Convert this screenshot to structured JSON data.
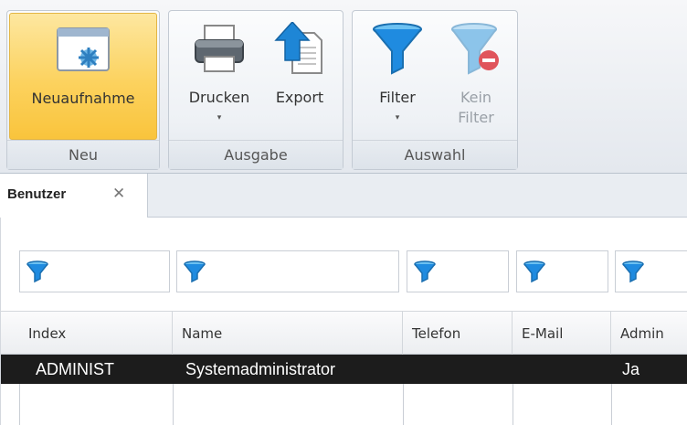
{
  "ribbon": {
    "groups": {
      "neu": {
        "label": "Neu",
        "buttons": {
          "neuaufnahme": "Neuaufnahme"
        }
      },
      "ausgabe": {
        "label": "Ausgabe",
        "buttons": {
          "drucken": "Drucken",
          "export": "Export"
        }
      },
      "auswahl": {
        "label": "Auswahl",
        "buttons": {
          "filter": "Filter",
          "kein_filter_1": "Kein",
          "kein_filter_2": "Filter"
        }
      }
    },
    "caret": "▾"
  },
  "tabs": [
    {
      "label": "Benutzer",
      "close": "✕"
    }
  ],
  "grid": {
    "columns": [
      "Index",
      "Name",
      "Telefon",
      "E-Mail",
      "Admin"
    ],
    "rows": [
      {
        "index": "ADMINIST",
        "name": "Systemadministrator",
        "telefon": "",
        "email": "",
        "admin": "Ja"
      }
    ]
  },
  "colors": {
    "active": "#fcd25e",
    "selected_row": "#1c1c1c",
    "funnel": "#1f8be0"
  }
}
